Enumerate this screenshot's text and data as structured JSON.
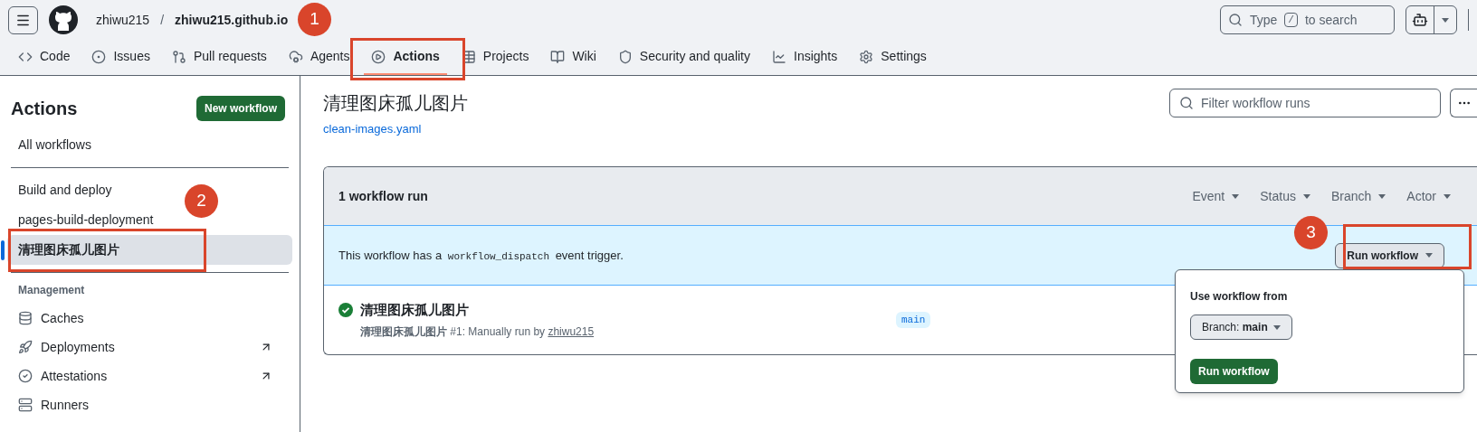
{
  "header": {
    "owner": "zhiwu215",
    "separator": "/",
    "repo": "zhiwu215.github.io",
    "search": {
      "before": "Type",
      "key": "/",
      "after": "to search"
    }
  },
  "tabs": [
    {
      "label": "Code",
      "selected": false
    },
    {
      "label": "Issues",
      "selected": false
    },
    {
      "label": "Pull requests",
      "selected": false
    },
    {
      "label": "Agents",
      "selected": false
    },
    {
      "label": "Actions",
      "selected": true
    },
    {
      "label": "Projects",
      "selected": false
    },
    {
      "label": "Wiki",
      "selected": false
    },
    {
      "label": "Security and quality",
      "selected": false
    },
    {
      "label": "Insights",
      "selected": false
    },
    {
      "label": "Settings",
      "selected": false
    }
  ],
  "sidebar": {
    "title": "Actions",
    "new_button": "New workflow",
    "all": {
      "label": "All workflows",
      "selected": false
    },
    "workflows": [
      {
        "label": "Build and deploy",
        "selected": false
      },
      {
        "label": "pages-build-deployment",
        "selected": false
      },
      {
        "label": "清理图床孤儿图片",
        "selected": true
      }
    ],
    "section": "Management",
    "management": [
      {
        "label": "Caches",
        "external": false
      },
      {
        "label": "Deployments",
        "external": true
      },
      {
        "label": "Attestations",
        "external": true
      },
      {
        "label": "Runners",
        "external": false
      }
    ]
  },
  "main": {
    "title": "清理图床孤儿图片",
    "file": "clean-images.yaml",
    "filter": {
      "placeholder": "Filter workflow runs"
    },
    "card": {
      "count": "1 workflow run",
      "filters": [
        "Event",
        "Status",
        "Branch",
        "Actor"
      ],
      "banner": {
        "before": "This workflow has a",
        "code": "workflow_dispatch",
        "after": "event trigger."
      },
      "run_button": "Run workflow",
      "runs": [
        {
          "kind": "success",
          "title": "清理图床孤儿图片",
          "subtitle": "**清理图床孤儿图片** #1: Manually run by",
          "actor": "zhiwu215",
          "branch": "main"
        }
      ]
    },
    "popover": {
      "heading": "Use workflow from",
      "branch": "Branch: **main**",
      "button": "Run workflow"
    }
  },
  "annotations": [
    {
      "label": "1"
    },
    {
      "label": "2"
    },
    {
      "label": "3"
    }
  ]
}
